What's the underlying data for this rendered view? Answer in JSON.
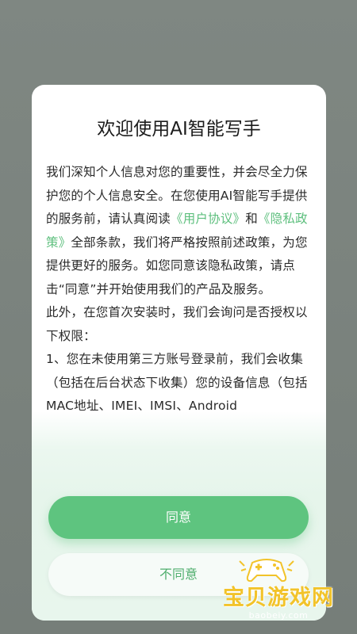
{
  "dialog": {
    "title": "欢迎使用AI智能写手",
    "paragraphs": [
      {
        "before": "我们深知个人信息对您的重要性，并会尽全力保护您的个人信息安全。在您使用AI智能写手提供的服务前，请认真阅读",
        "link1": "《用户协议》",
        "mid": "和",
        "link2": "《隐私政策》",
        "after": "全部条款，我们将严格按照前述政策，为您提供更好的服务。如您同意该隐私政策，请点击“同意”并开始使用我们的产品及服务。"
      }
    ],
    "para2": "此外，在您首次安装时，我们会询问是否授权以下权限：",
    "para3": "1、您在未使用第三方账号登录前，我们会收集（包括在后台状态下收集）您的设备信息（包括MAC地址、IMEI、IMSI、Android",
    "agree_label": "同意",
    "disagree_label": "不同意"
  },
  "watermark": {
    "text": "宝贝游戏网",
    "url": "baobeiy.com"
  },
  "colors": {
    "accent": "#5ec47f",
    "link": "#5dbf7d",
    "overlay": "#7a827d"
  }
}
